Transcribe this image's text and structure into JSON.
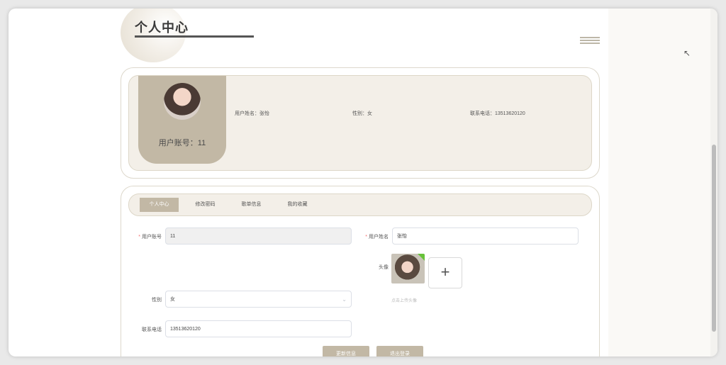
{
  "header": {
    "title": "个人中心"
  },
  "profile": {
    "account_label": "用户账号：",
    "account_value": "11",
    "name_text": "用户姓名：张怡",
    "gender_text": "性别：女",
    "phone_text": "联系电话：13513620120"
  },
  "tabs": [
    {
      "label": "个人中心",
      "active": true
    },
    {
      "label": "修改密码"
    },
    {
      "label": "歌单信息"
    },
    {
      "label": "我的收藏"
    }
  ],
  "form": {
    "account_label": "用户账号",
    "account_value": "11",
    "name_label": "用户姓名",
    "name_value": "张怡",
    "avatar_label": "头像",
    "upload_hint": "点击上传头像",
    "gender_label": "性别",
    "gender_value": "女",
    "phone_label": "联系电话",
    "phone_value": "13513620120"
  },
  "buttons": {
    "update": "更新信息",
    "logout": "退出登录"
  },
  "icons": {
    "menu": "hamburger-icon",
    "upload": "plus-icon",
    "cursor": "mouse-pointer-icon"
  },
  "colors": {
    "accent": "#c2b8a5",
    "panel_bg": "#f3efe8",
    "required": "#f56c6c"
  }
}
